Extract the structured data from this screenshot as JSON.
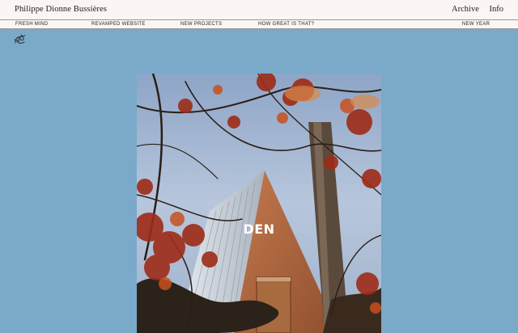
{
  "header": {
    "site_title": "Philippe Dionne Bussières",
    "archive_label": "Archive",
    "info_label": "Info"
  },
  "ticker": {
    "items": [
      "FRESH MIND",
      "REVAMPED WEBSITE",
      "NEW PROJECTS",
      "HOW GREAT IS THAT?",
      "NEW YEAR"
    ]
  },
  "logo_icon": "squiggle-logo-icon",
  "project": {
    "title": "DEN"
  },
  "colors": {
    "page_background": "#7ba9c9",
    "header_background": "#fbf6f3",
    "text": "#1d1d1d"
  }
}
